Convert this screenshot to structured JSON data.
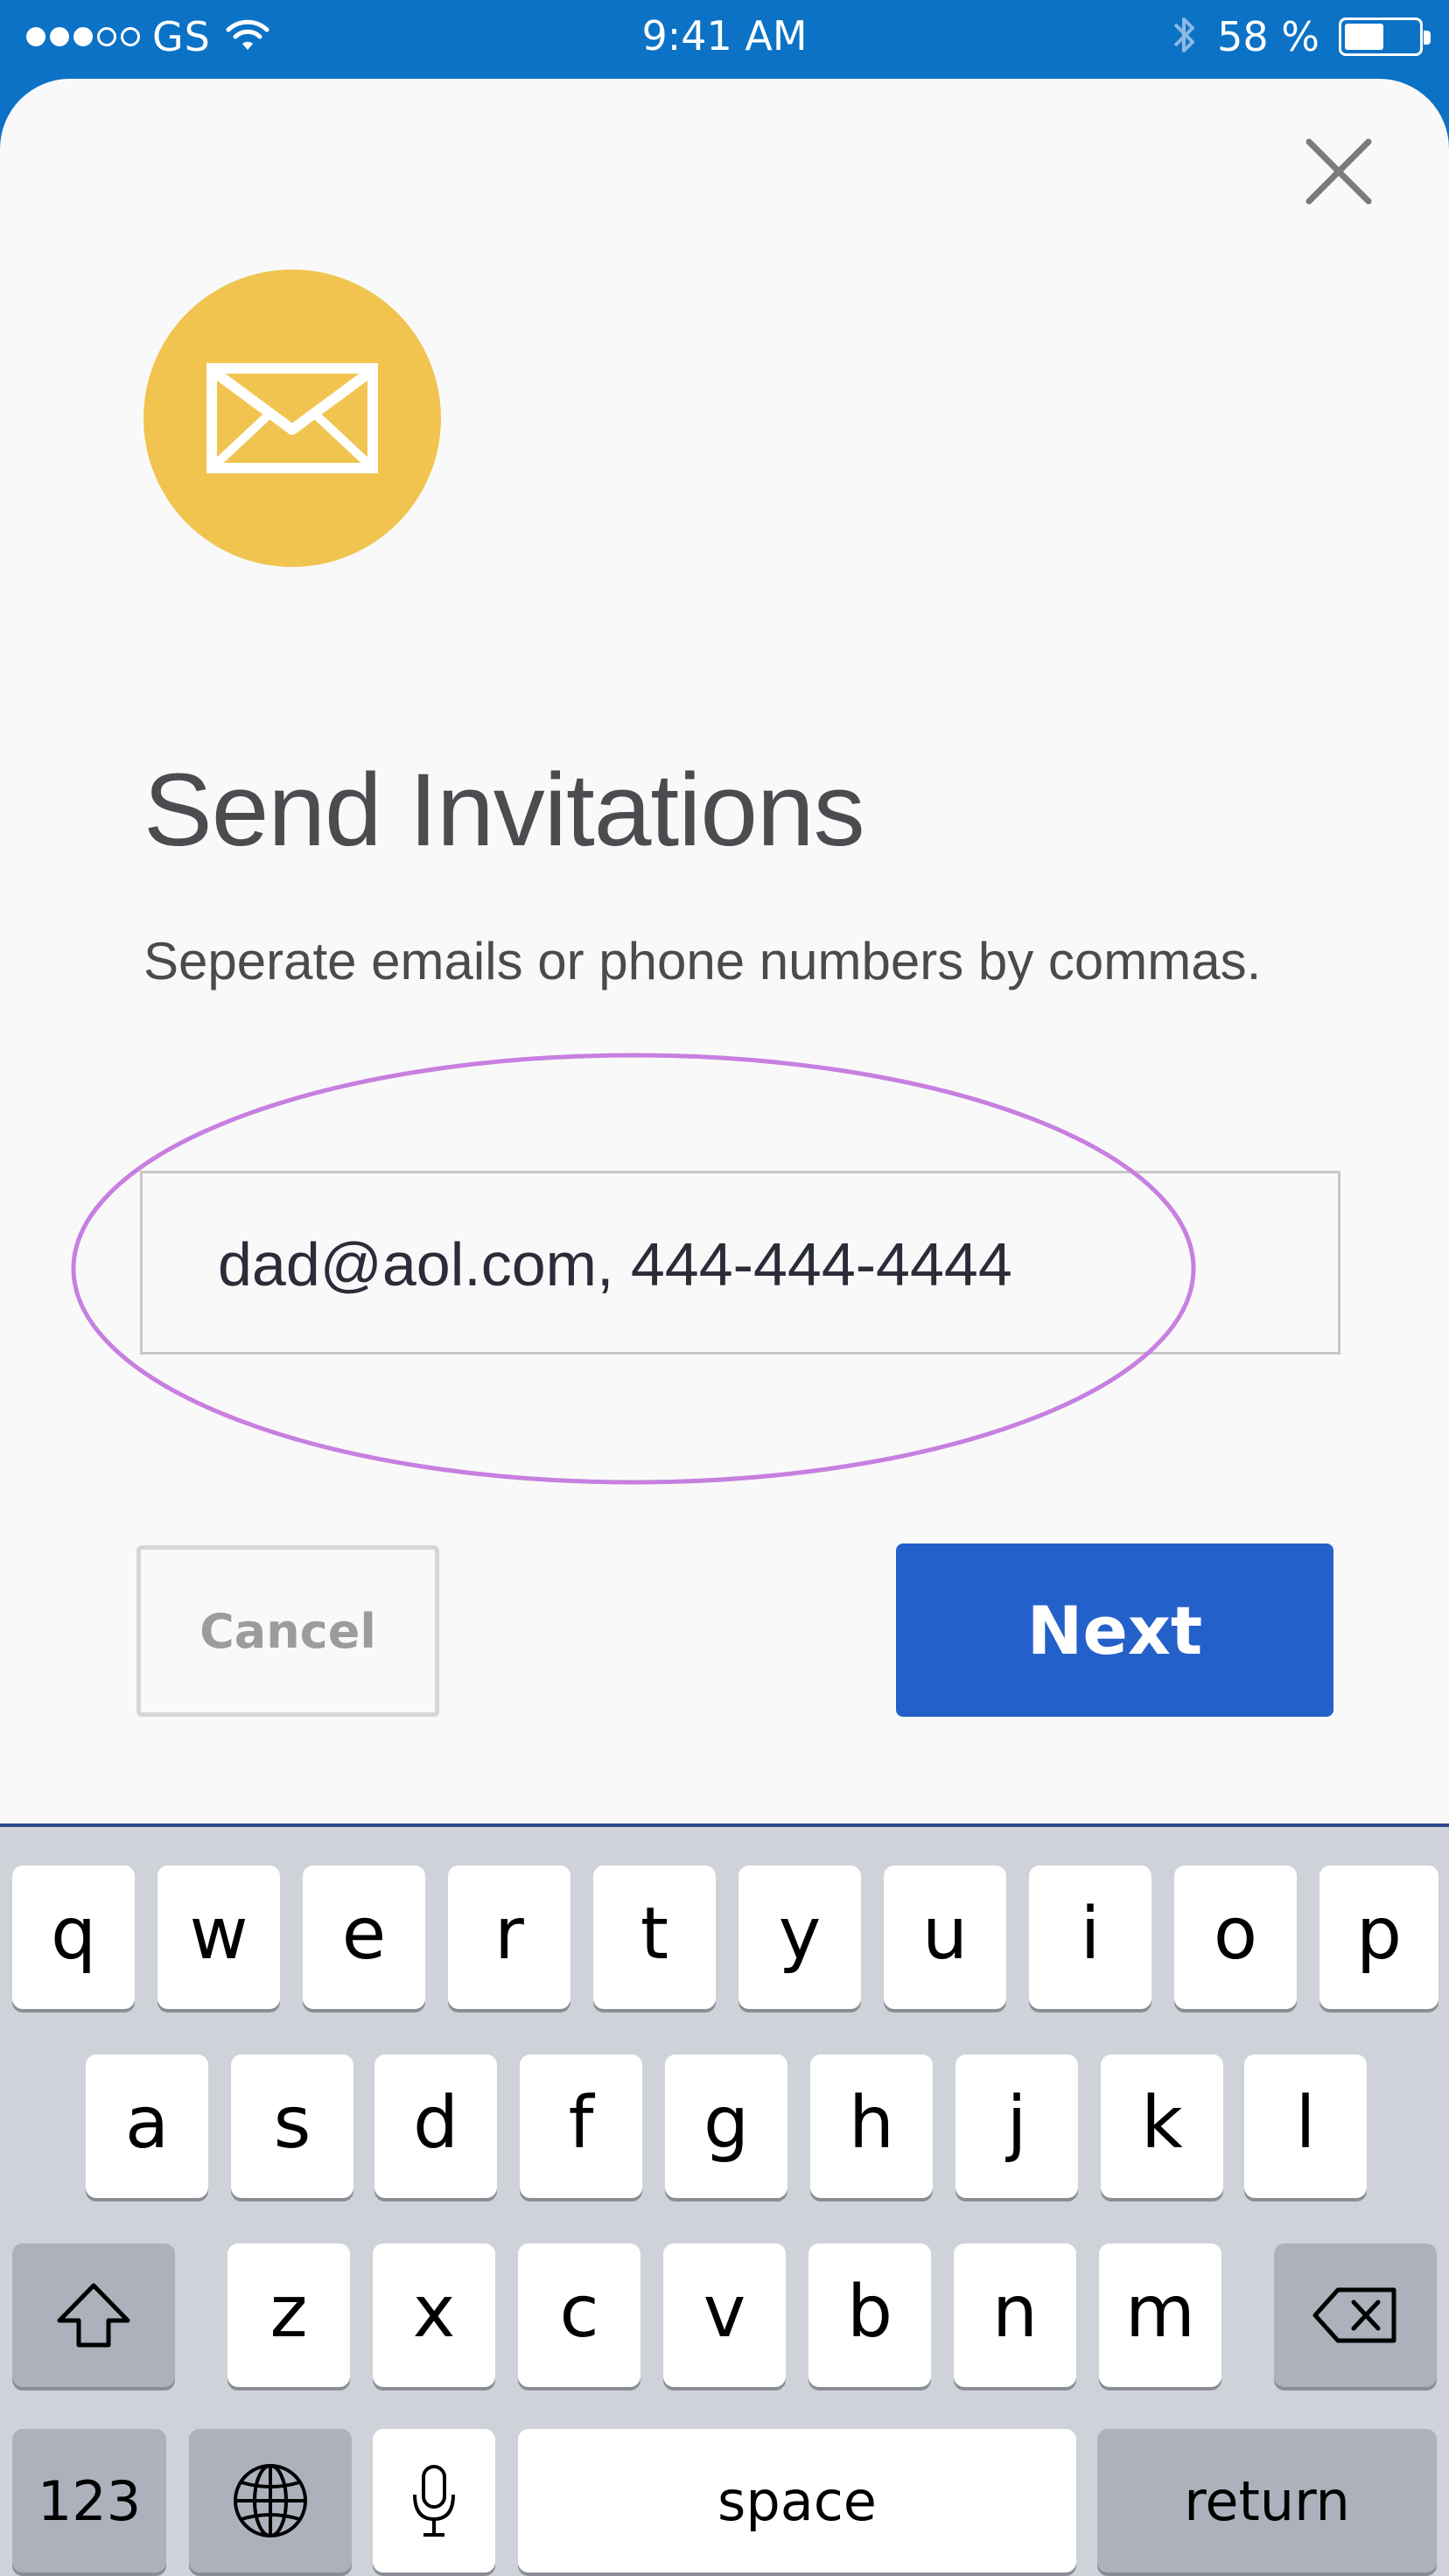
{
  "status_bar": {
    "carrier": "GS",
    "time": "9:41 AM",
    "battery_percent": "58 %",
    "battery_level": 0.58,
    "icons": [
      "signal-dots-icon",
      "wifi-icon",
      "bluetooth-icon",
      "battery-icon"
    ]
  },
  "dialog": {
    "close_icon": "close-icon",
    "header_icon": "envelope-icon",
    "title": "Send Invitations",
    "subtitle": "Seperate emails or phone numbers by commas.",
    "input_value": "dad@aol.com, 444-444-4444",
    "cancel_label": "Cancel",
    "next_label": "Next"
  },
  "colors": {
    "status_bar": "#0b72c6",
    "icon_circle": "#f0c44f",
    "next_button": "#2460c9",
    "highlight_ellipse": "#c77fe0",
    "keyboard_bg": "#cfd2d9"
  },
  "keyboard": {
    "row1": [
      "q",
      "w",
      "e",
      "r",
      "t",
      "y",
      "u",
      "i",
      "o",
      "p"
    ],
    "row2": [
      "a",
      "s",
      "d",
      "f",
      "g",
      "h",
      "j",
      "k",
      "l"
    ],
    "row3": [
      "z",
      "x",
      "c",
      "v",
      "b",
      "n",
      "m"
    ],
    "numbers_key": "123",
    "space_key": "space",
    "return_key": "return",
    "shift_icon": "shift-icon",
    "delete_icon": "backspace-icon",
    "globe_icon": "globe-icon",
    "mic_icon": "microphone-icon"
  }
}
